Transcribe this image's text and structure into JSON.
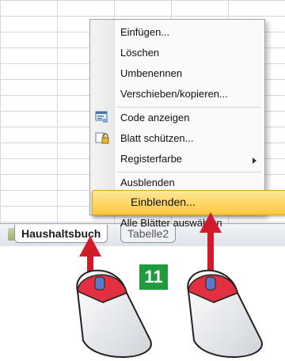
{
  "context_menu": {
    "items": [
      {
        "label": "Einfügen..."
      },
      {
        "label": "Löschen"
      },
      {
        "label": "Umbenennen"
      },
      {
        "label": "Verschieben/kopieren..."
      },
      {
        "label": "Code anzeigen",
        "icon": "code-icon"
      },
      {
        "label": "Blatt schützen...",
        "icon": "lock-icon"
      },
      {
        "label": "Registerfarbe",
        "has_submenu": true
      },
      {
        "label": "Ausblenden"
      },
      {
        "label": "Einblenden..."
      },
      {
        "label": "Alle Blätter auswählen"
      }
    ],
    "highlighted": "Einblenden..."
  },
  "sheet_tabs": {
    "active": "Haushaltsbuch",
    "second": "Tabelle2"
  },
  "step_badge": "11",
  "colors": {
    "highlight": "#ffc83a",
    "badge": "#1f9a3d",
    "arrow": "#d11a2a"
  }
}
